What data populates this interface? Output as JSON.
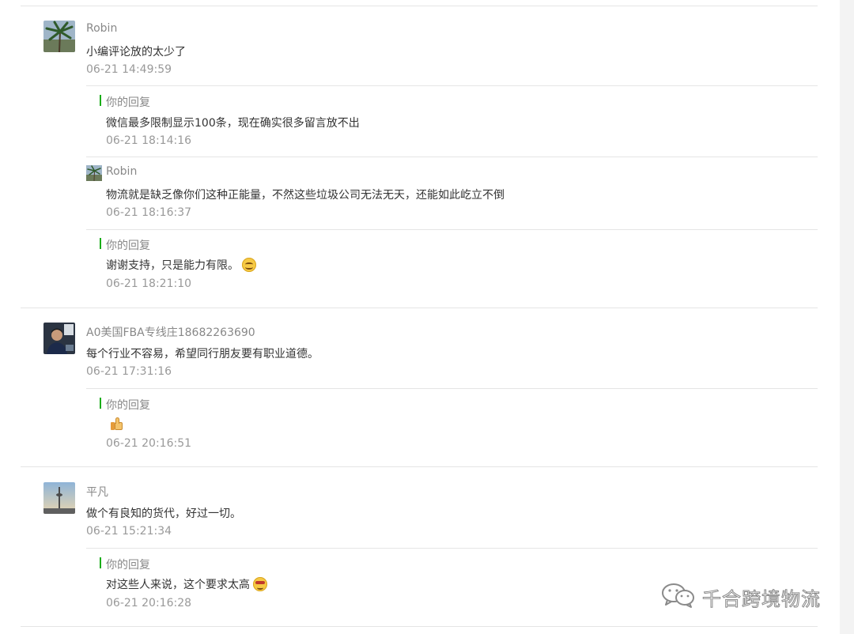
{
  "comments": [
    {
      "nickname": "Robin",
      "content": "小编评论放的太少了",
      "time": "06-21 14:49:59",
      "avatar": "palm-tree-avatar",
      "replies": [
        {
          "nickname": "你的回复",
          "content": "微信最多限制显示100条，现在确实很多留言放不出",
          "time": "06-21 18:14:16",
          "is_author": true
        },
        {
          "nickname": "Robin",
          "content": "物流就是缺乏像你们这种正能量，不然这些垃圾公司无法无天，还能如此屹立不倒",
          "time": "06-21 18:16:37",
          "is_author": false
        },
        {
          "nickname": "你的回复",
          "content": "谢谢支持，只是能力有限。",
          "emoji": "smile-emoji",
          "time": "06-21 18:21:10",
          "is_author": true
        }
      ]
    },
    {
      "nickname": "A0美国FBA专线庄18682263690",
      "content": "每个行业不容易，希望同行朋友要有职业道德。",
      "time": "06-21 17:31:16",
      "avatar": "person-avatar",
      "replies": [
        {
          "nickname": "你的回复",
          "content": "",
          "emoji": "thumbs-up-emoji",
          "time": "06-21 20:16:51",
          "is_author": true
        }
      ]
    },
    {
      "nickname": "平凡",
      "content": "做个有良知的货代，好过一切。",
      "time": "06-21 15:21:34",
      "avatar": "tower-avatar",
      "replies": [
        {
          "nickname": "你的回复",
          "content": "对这些人来说，这个要求太高",
          "emoji": "cool-emoji",
          "time": "06-21 20:16:28",
          "is_author": true
        }
      ]
    }
  ],
  "watermark": {
    "text": "千合跨境物流",
    "icon": "wechat-icon"
  },
  "colors": {
    "author_marker": "#1aad19",
    "divider": "#e5e5e5",
    "nickname": "#888888",
    "content": "#333333",
    "time": "#999999"
  }
}
